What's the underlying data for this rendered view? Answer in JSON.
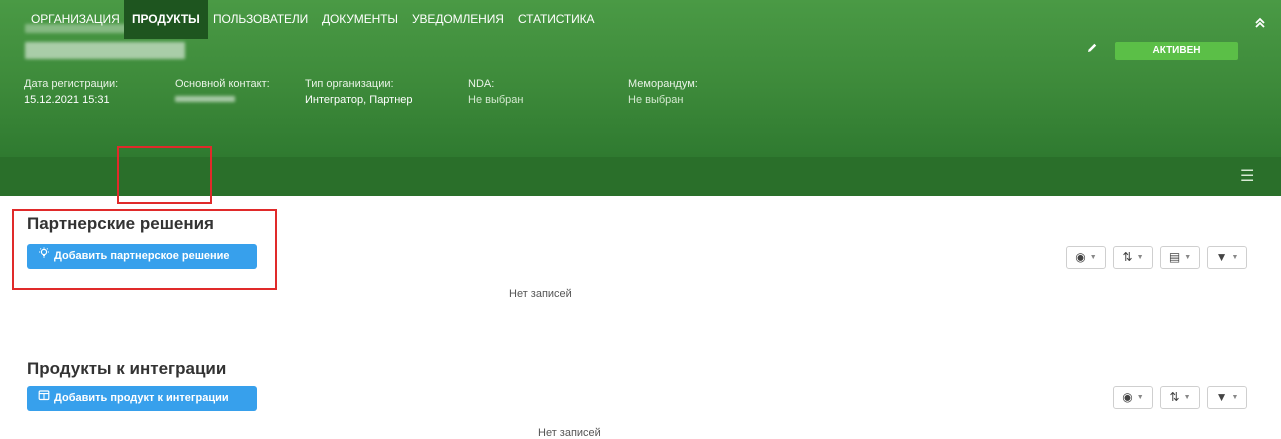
{
  "header": {
    "fields": [
      {
        "label": "Дата регистрации:",
        "value": "15.12.2021 15:31"
      },
      {
        "label": "Основной контакт:",
        "value": ""
      },
      {
        "label": "Тип организации:",
        "value": "Интегратор, Партнер"
      },
      {
        "label": "NDA:",
        "value": "Не выбран"
      },
      {
        "label": "Меморандум:",
        "value": "Не выбран"
      }
    ],
    "status": "АКТИВЕН",
    "icons": {
      "edit": "pencil-icon",
      "collapse": "double-chevron-up-icon"
    }
  },
  "tabs": [
    "ОРГАНИЗАЦИЯ",
    "ПРОДУКТЫ",
    "ПОЛЬЗОВАТЕЛИ",
    "ДОКУМЕНТЫ",
    "УВЕДОМЛЕНИЯ",
    "СТАТИСТИКА"
  ],
  "active_tab": "ПРОДУКТЫ",
  "sections": [
    {
      "title": "Партнерские решения",
      "add_button": "Добавить партнерское решение",
      "empty_text": "Нет записей"
    },
    {
      "title": "Продукты к интеграции",
      "add_button": "Добавить продукт к интеграции",
      "empty_text": "Нет записей"
    }
  ],
  "colors": {
    "header_green": "#3d8a3a",
    "tabbar_green": "#2a6f2a",
    "status_green": "#5bbf47",
    "button_blue": "#37a0ec",
    "highlight_red": "#e02a2a"
  }
}
